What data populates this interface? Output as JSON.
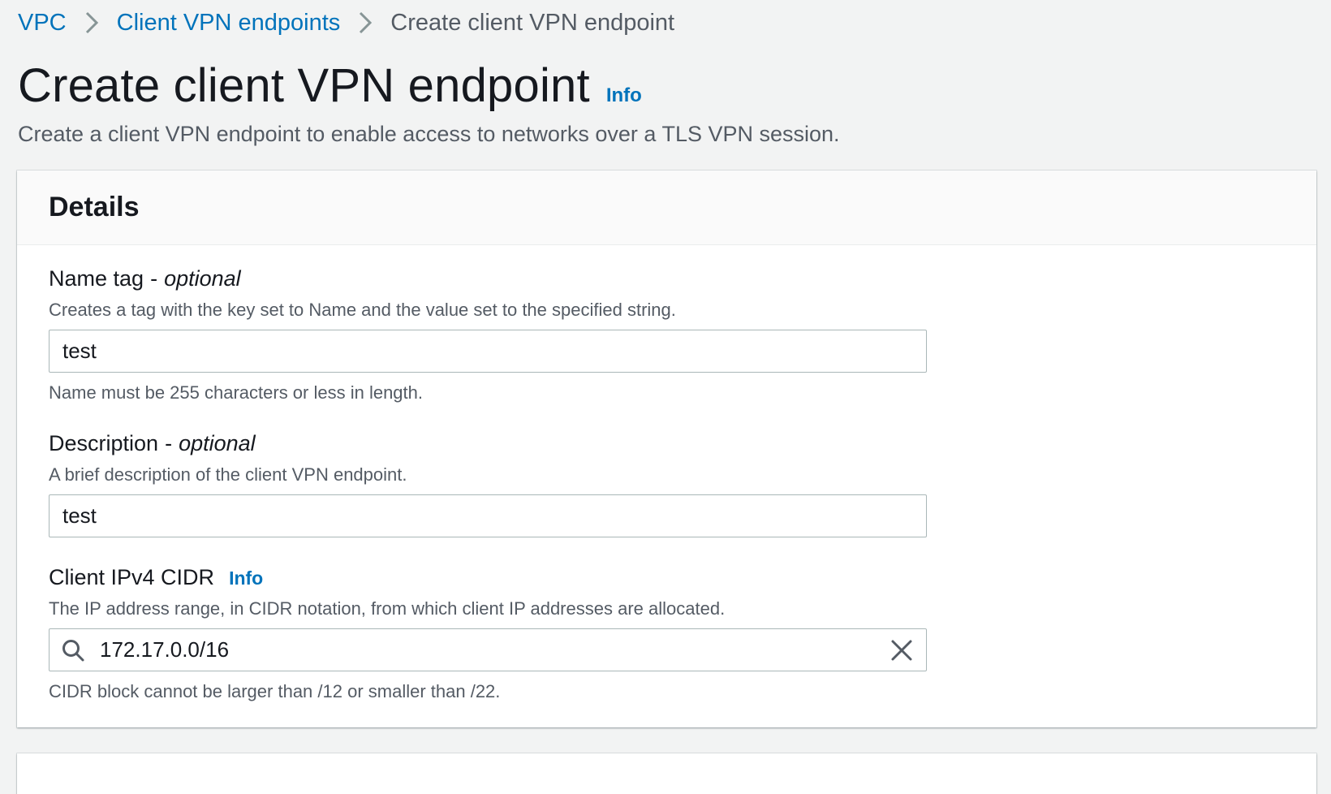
{
  "breadcrumb": {
    "items": [
      {
        "label": "VPC"
      },
      {
        "label": "Client VPN endpoints"
      },
      {
        "label": "Create client VPN endpoint"
      }
    ],
    "separator_icon": "chevron-right-icon"
  },
  "header": {
    "title": "Create client VPN endpoint",
    "info_label": "Info",
    "description": "Create a client VPN endpoint to enable access to networks over a TLS VPN session."
  },
  "details": {
    "title": "Details",
    "name_tag": {
      "label": "Name tag",
      "dash": "-",
      "optional": "optional",
      "description": "Creates a tag with the key set to Name and the value set to the specified string.",
      "value": "test",
      "hint": "Name must be 255 characters or less in length."
    },
    "description_field": {
      "label": "Description",
      "dash": "-",
      "optional": "optional",
      "description": "A brief description of the client VPN endpoint.",
      "value": "test"
    },
    "client_cidr": {
      "label": "Client IPv4 CIDR",
      "info_label": "Info",
      "description": "The IP address range, in CIDR notation, from which client IP addresses are allocated.",
      "value": "172.17.0.0/16",
      "hint": "CIDR block cannot be larger than /12 or smaller than /22.",
      "left_icon": "search-icon",
      "right_icon": "close-icon"
    }
  },
  "colors": {
    "link": "#0073bb",
    "text": "#16191f",
    "secondary_text": "#545b64",
    "background": "#f2f3f3",
    "border": "#aab7b8"
  }
}
